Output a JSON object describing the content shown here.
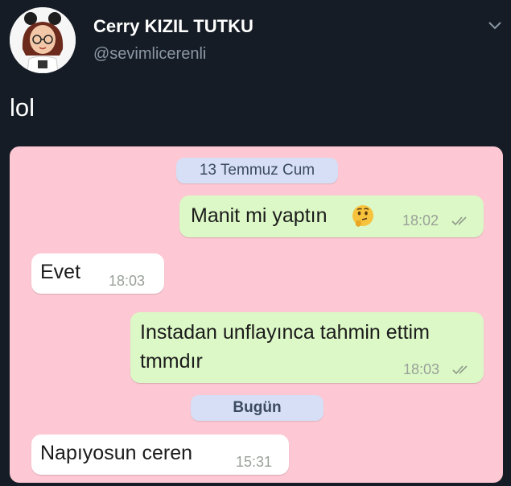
{
  "tweet": {
    "author": {
      "display_name": "Cerry KIZIL TUTKU",
      "handle": "@sevimlicerenli",
      "avatar_icon": "cartoon-girl-avatar"
    },
    "menu_icon": "chevron-down-icon",
    "text": "lol"
  },
  "chat": {
    "background_color": "#fdc8d3",
    "dates": [
      "13 Temmuz Cum",
      "Bugün"
    ],
    "messages": [
      {
        "direction": "outgoing",
        "text": "Manit mi yaptın",
        "emoji": "thinking-face-emoji",
        "time": "18:02",
        "status": "read-double-check"
      },
      {
        "direction": "incoming",
        "text": "Evet",
        "time": "18:03"
      },
      {
        "direction": "outgoing",
        "lines": [
          "Instadan unflayınca tahmin ettim",
          "tmmdır"
        ],
        "time": "18:03",
        "status": "read-double-check"
      },
      {
        "direction": "incoming",
        "text": "Napıyosun ceren",
        "time": "15:31"
      }
    ]
  },
  "colors": {
    "page_bg": "#151c25",
    "outgoing_bubble": "#dcf8c6",
    "incoming_bubble": "#ffffff",
    "date_pill": "#d6dff5"
  }
}
